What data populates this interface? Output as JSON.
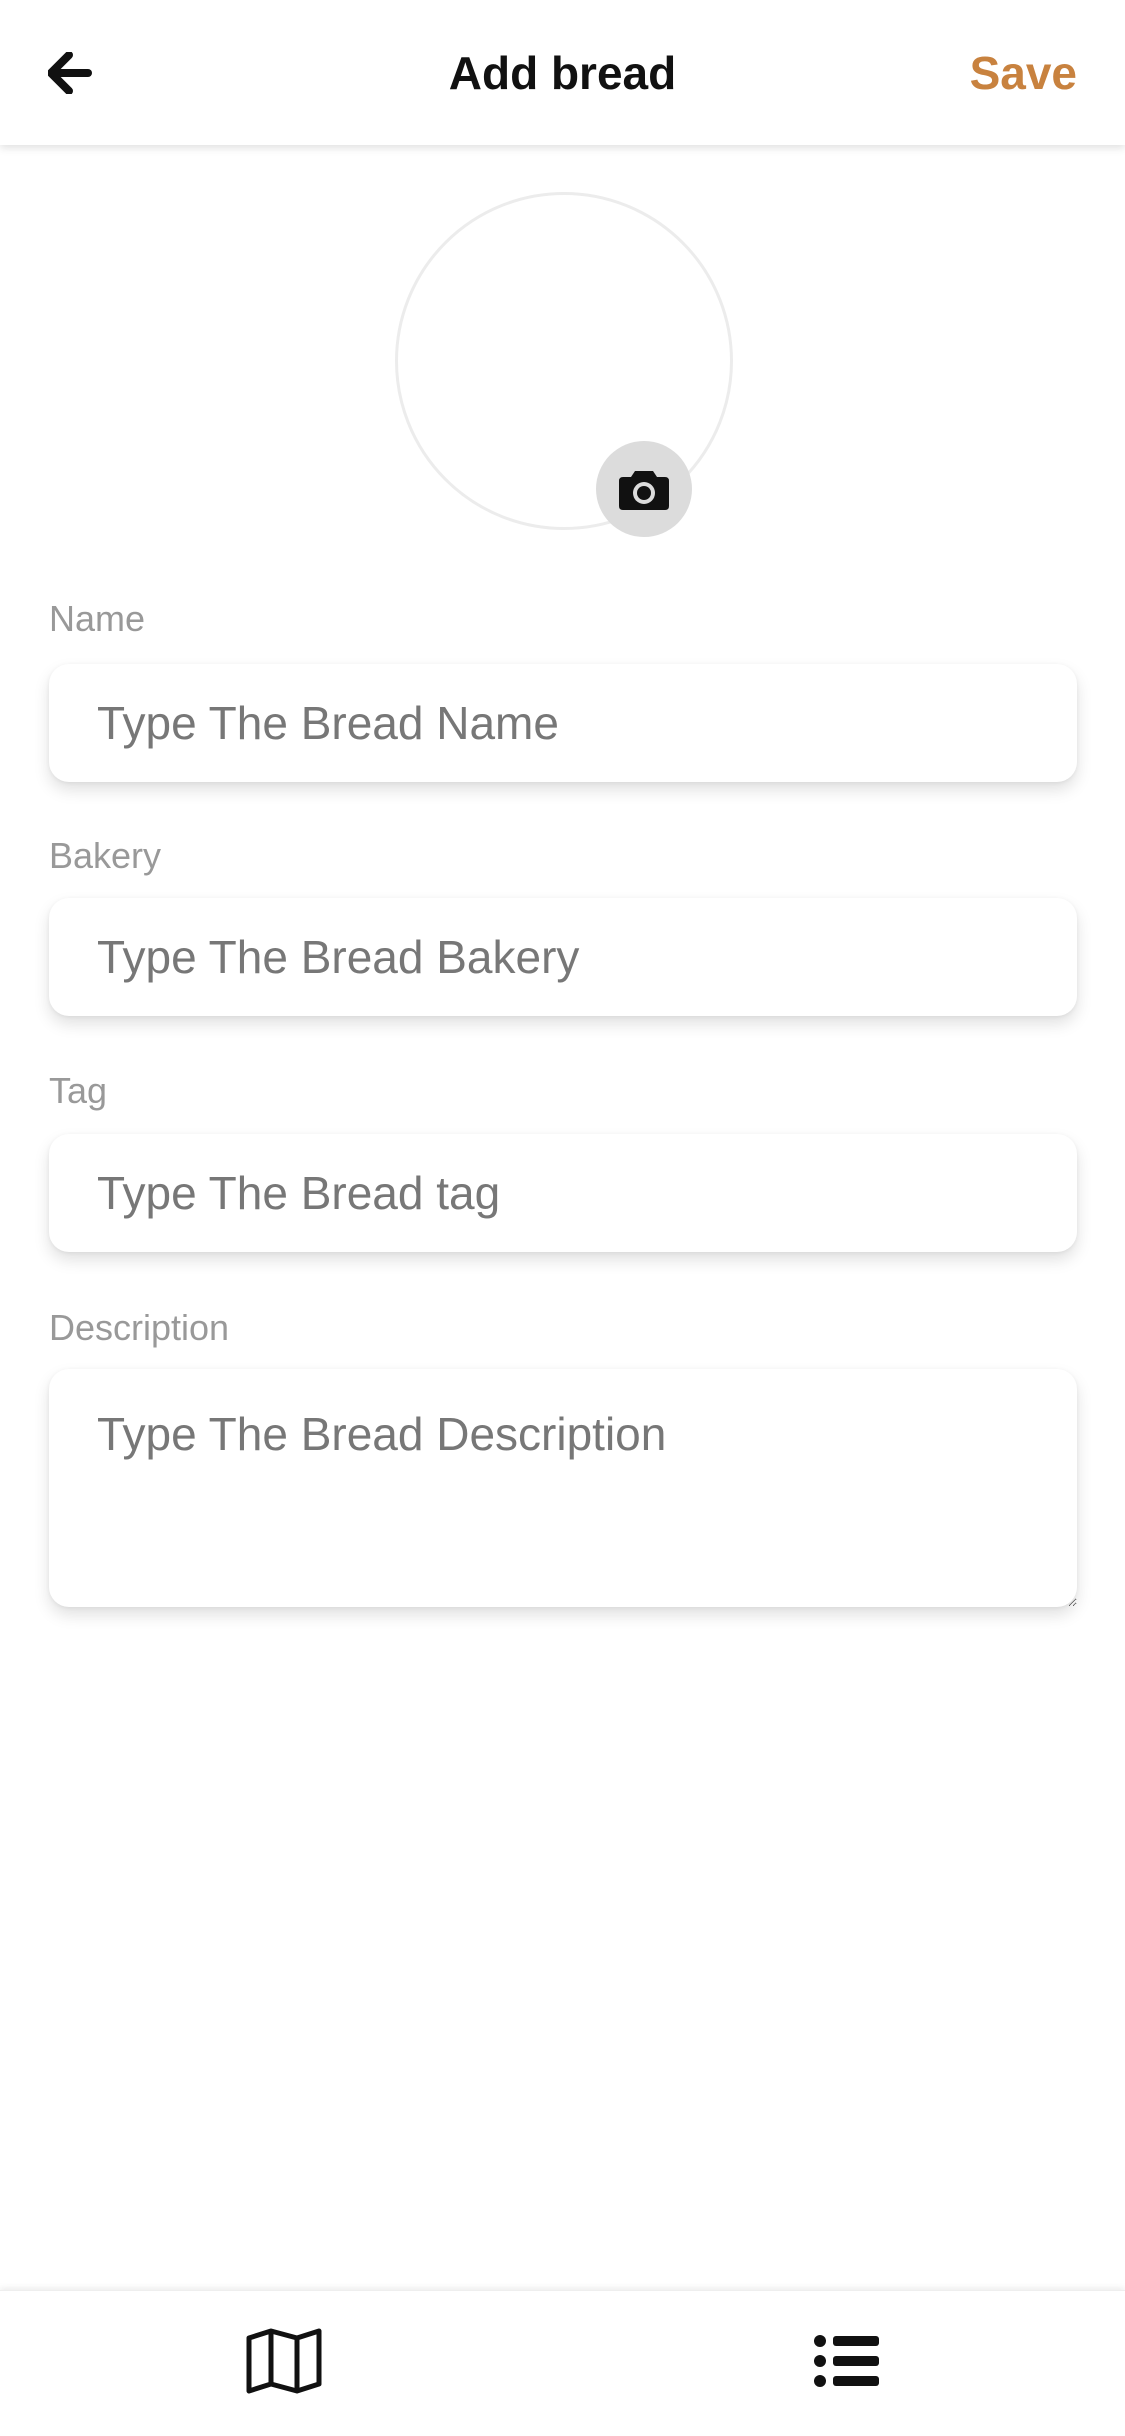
{
  "header": {
    "title": "Add bread",
    "save_label": "Save",
    "back_icon": "arrow-left-icon",
    "save_color": "#C8823F"
  },
  "avatar": {
    "camera_icon": "camera-icon"
  },
  "form": {
    "name": {
      "label": "Name",
      "placeholder": "Type The Bread Name",
      "value": ""
    },
    "bakery": {
      "label": "Bakery",
      "placeholder": "Type The Bread Bakery",
      "value": ""
    },
    "tag": {
      "label": "Tag",
      "placeholder": "Type The Bread tag",
      "value": ""
    },
    "description": {
      "label": "Description",
      "placeholder": "Type The Bread Description",
      "value": ""
    }
  },
  "bottom_nav": {
    "items": [
      {
        "icon": "map-icon"
      },
      {
        "icon": "list-icon"
      }
    ]
  }
}
